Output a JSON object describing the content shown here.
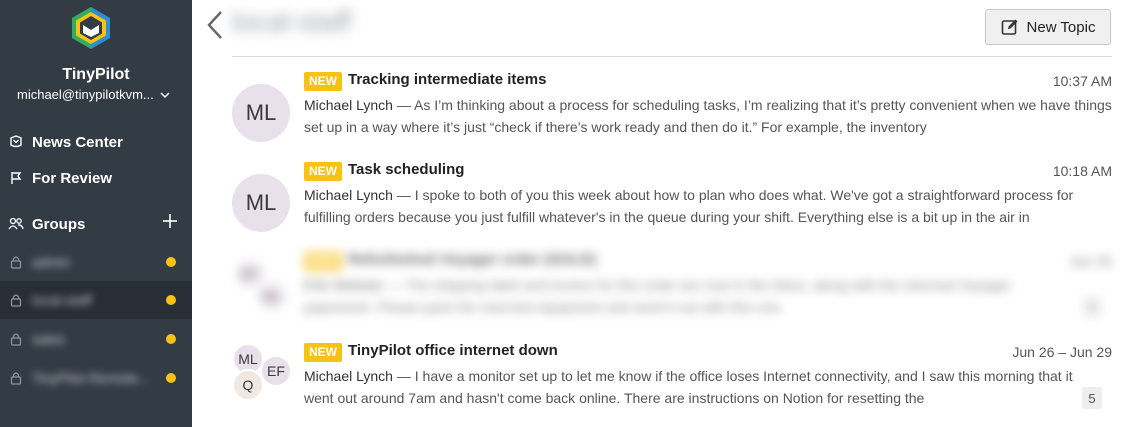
{
  "sidebar": {
    "org_name": "TinyPilot",
    "org_email": "michael@tinypilotkvm...",
    "nav": [
      {
        "label": "News Center"
      },
      {
        "label": "For Review"
      }
    ],
    "groups_label": "Groups",
    "groups": [
      {
        "name": "admin",
        "unread": true,
        "active": false
      },
      {
        "name": "local-staff",
        "unread": true,
        "active": true
      },
      {
        "name": "sales",
        "unread": true,
        "active": false
      },
      {
        "name": "TinyPilot Remote...",
        "unread": true,
        "active": false
      }
    ]
  },
  "header": {
    "title": "local-staff",
    "new_topic_label": "New Topic"
  },
  "colors": {
    "sidebar_bg": "#333b44",
    "accent_yellow": "#f6c315",
    "avatar_bg": "#e8e0ea"
  },
  "topics": [
    {
      "badge": "NEW",
      "title": "Tracking intermediate items",
      "time": "10:37 AM",
      "author": "Michael Lynch",
      "excerpt": " — As I’m thinking about a process for scheduling tasks, I’m realizing that it’s pretty convenient when we have things set up in a way where it’s just “check if there’s work ready and then do it.” For example, the inventory",
      "avatars": [
        "ML"
      ]
    },
    {
      "badge": "NEW",
      "title": "Task scheduling",
      "time": "10:18 AM",
      "author": "Michael Lynch",
      "excerpt": " — I spoke to both of you this week about how to plan who does what. We've got a straightforward process for fulfilling orders because you just fulfill whatever's in the queue during your shift. Everything else is a bit up in the air in",
      "avatars": [
        "ML"
      ]
    },
    {
      "badge": "NEW",
      "title": "Refurbished Voyager order (SOLD)",
      "time": "Jun 30",
      "author": "Erik Webster",
      "excerpt": " — The shipping label and invoice for this order are now in the inbox, along with the returned Voyager paperwork. Please pack the returned equipment and send it out with this one.",
      "avatars": [
        "EF",
        "ML"
      ],
      "replies": "3"
    },
    {
      "badge": "NEW",
      "title": "TinyPilot office internet down",
      "time": "Jun 26 – Jun 29",
      "author": "Michael Lynch",
      "excerpt": " — I have a monitor set up to let me know if the office loses Internet connectivity, and I saw this morning that it went out around 7am and hasn't come back online. There are instructions on Notion for resetting the",
      "avatars": [
        "ML",
        "EF",
        "Q"
      ],
      "replies": "5"
    }
  ]
}
